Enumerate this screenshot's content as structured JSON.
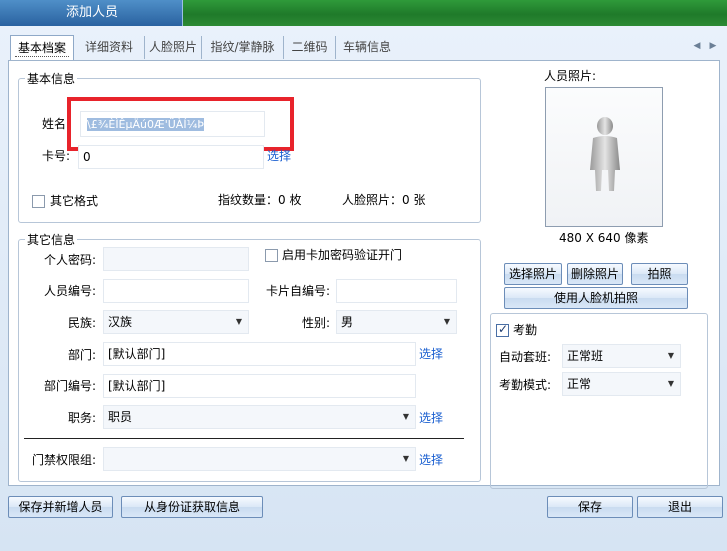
{
  "window": {
    "title": "添加人员"
  },
  "tabs": [
    "基本档案",
    "详细资料",
    "人脸照片",
    "指纹/掌静脉",
    "二维码",
    "车辆信息"
  ],
  "basic_info": {
    "legend": "基本信息",
    "name_label": "姓名",
    "name_value": "\\£¾ÈÌÊµÄú0Æ'ÜÀÍ¼Þ",
    "card_label": "卡号:",
    "card_value": "0",
    "card_select": "选择",
    "other_format_label": "其它格式",
    "fingerprint_count": "指纹数量：0 枚",
    "face_count": "人脸照片：0 张"
  },
  "other_info": {
    "legend": "其它信息",
    "personal_pwd_label": "个人密码:",
    "personal_pwd_value": "",
    "card_pwd_check_label": "启用卡加密码验证开门",
    "staff_no_label": "人员编号:",
    "staff_no_value": "",
    "card_self_no_label": "卡片自编号:",
    "card_self_no_value": "",
    "ethnicity_label": "民族:",
    "ethnicity_value": "汉族",
    "gender_label": "性别:",
    "gender_value": "男",
    "dept_label": "部门:",
    "dept_value": "[默认部门]",
    "dept_select": "选择",
    "dept_no_label": "部门编号:",
    "dept_no_value": "[默认部门]",
    "position_label": "职务:",
    "position_value": "职员",
    "position_select": "选择",
    "access_group_label": "门禁权限组:",
    "access_group_value": "",
    "access_group_select": "选择"
  },
  "photo": {
    "label": "人员照片:",
    "size_text": "480 X 640 像素",
    "select_btn": "选择照片",
    "delete_btn": "删除照片",
    "take_btn": "拍照",
    "face_machine_btn": "使用人脸机拍照"
  },
  "attendance": {
    "check_label": "考勤",
    "checked": true,
    "shift_label": "自动套班:",
    "shift_value": "正常班",
    "mode_label": "考勤模式:",
    "mode_value": "正常"
  },
  "footer": {
    "save_add_btn": "保存并新增人员",
    "id_card_btn": "从身份证获取信息",
    "save_btn": "保存",
    "exit_btn": "退出"
  },
  "colors": {
    "titlebar_green": "#1f7a2a",
    "title_blue": "#2a62a0",
    "highlight_red": "#e8232b",
    "link_blue": "#1a5fd0"
  }
}
